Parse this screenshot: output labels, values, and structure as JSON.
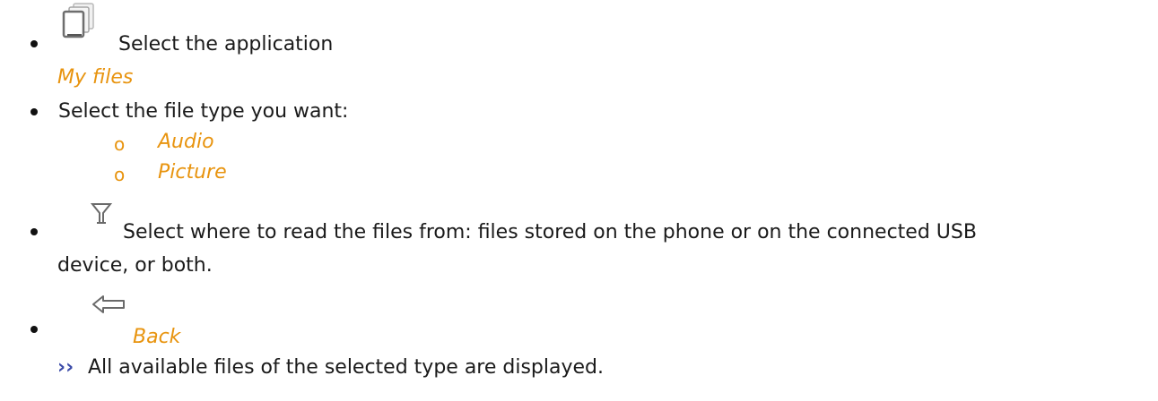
{
  "steps": [
    {
      "icon": "my-files-icon",
      "text": "Select the application",
      "sub": "My files"
    },
    {
      "text": "Select the file type you want:",
      "options": [
        "Audio",
        "Picture"
      ]
    },
    {
      "icon": "filter-icon",
      "text_line1": "Select where to read the files from: files stored on the phone or on the connected USB",
      "text_line2": "device, or both."
    },
    {
      "icon": "back-arrow-icon",
      "text": "Back"
    }
  ],
  "result": {
    "marker": "››",
    "text": "All available files of the selected type are displayed."
  },
  "colors": {
    "accent": "#e8940f",
    "marker": "#3a4aa8"
  }
}
